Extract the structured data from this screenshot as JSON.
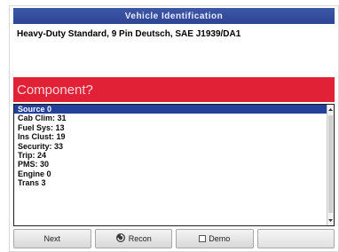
{
  "window": {
    "title": "Vehicle Identification"
  },
  "vehicle": {
    "description": "Heavy-Duty Standard, 9 Pin Deutsch, SAE J1939/DA1"
  },
  "banner": {
    "label": "Component?"
  },
  "list": {
    "items": [
      {
        "label": "Source 0",
        "selected": true
      },
      {
        "label": "Cab Clim: 31"
      },
      {
        "label": "Fuel Sys: 13"
      },
      {
        "label": "Ins Clust: 19"
      },
      {
        "label": "Security: 33"
      },
      {
        "label": "Trip: 24"
      },
      {
        "label": "PMS: 30"
      },
      {
        "label": "Engine 0"
      },
      {
        "label": "Trans 3"
      }
    ]
  },
  "buttons": {
    "next": "Next",
    "recon": "Recon",
    "demo": "Demo"
  },
  "colors": {
    "title_bar": "#2d4593",
    "banner": "#e02136",
    "selection": "#23419a"
  },
  "icons": {
    "recon": "recon-icon",
    "scroll_up": "chevron-up-icon",
    "scroll_down": "chevron-down-icon"
  }
}
